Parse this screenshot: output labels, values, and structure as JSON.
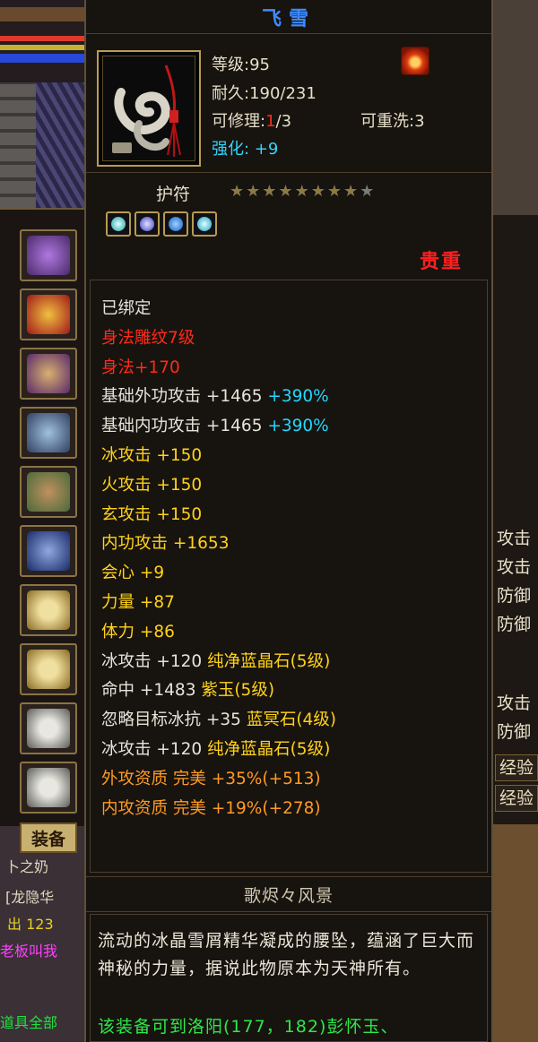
{
  "item": {
    "name": "飞雪",
    "level_label": "等级:95",
    "durability_label": "耐久:190/231",
    "repair_prefix": "可修理:",
    "repair_current": "1",
    "repair_suffix": "/3",
    "rewash_label": "可重洗:3",
    "strength_label": "强化: +9",
    "charm_label": "护符",
    "star_glyph": "★",
    "stars_filled": 8,
    "stars_total": 9,
    "rarity": "贵重",
    "set_name": "歌烬々风景"
  },
  "attributes": [
    {
      "text": "已绑定",
      "color": "white"
    },
    {
      "text": "身法雕纹7级",
      "color": "red"
    },
    {
      "text": "身法+170",
      "color": "red"
    },
    {
      "text": "基础外功攻击 +1465",
      "color": "white",
      "extra": " +390%",
      "extra_color": "cyan"
    },
    {
      "text": "基础内功攻击 +1465",
      "color": "white",
      "extra": " +390%",
      "extra_color": "cyan"
    },
    {
      "text": "冰攻击 +150",
      "color": "yellow"
    },
    {
      "text": "火攻击 +150",
      "color": "yellow"
    },
    {
      "text": "玄攻击 +150",
      "color": "yellow"
    },
    {
      "text": "内功攻击 +1653",
      "color": "yellow"
    },
    {
      "text": "会心 +9",
      "color": "yellow"
    },
    {
      "text": "力量 +87",
      "color": "yellow"
    },
    {
      "text": "体力 +86",
      "color": "yellow"
    },
    {
      "text": "冰攻击 +120 ",
      "color": "white",
      "extra": "纯净蓝晶石(5级)",
      "extra_color": "yellow"
    },
    {
      "text": "命中 +1483 ",
      "color": "white",
      "extra": "紫玉(5级)",
      "extra_color": "yellow"
    },
    {
      "text": "忽略目标冰抗 +35 ",
      "color": "white",
      "extra": "蓝冥石(4级)",
      "extra_color": "yellow"
    },
    {
      "text": "冰攻击 +120 ",
      "color": "white",
      "extra": "纯净蓝晶石(5级)",
      "extra_color": "yellow"
    },
    {
      "text": "外攻资质  完美 +35%(+513)",
      "color": "orange"
    },
    {
      "text": "内攻资质  完美 +19%(+278)",
      "color": "orange"
    }
  ],
  "description": "流动的冰晶雪屑精华凝成的腰坠，蕴涵了巨大而神秘的力量，据说此物原本为天神所有。",
  "location_hint": "该装备可到洛阳(177，182)彭怀玉、",
  "left_panel": {
    "equip_tab": "装备",
    "line1": "卜之奶",
    "line2": "[龙隐华",
    "line3": "出  123",
    "line4": "老板叫我",
    "line5": "道具全部"
  },
  "right_panel": {
    "labels": [
      "攻击",
      "攻击",
      "防御",
      "防御",
      "攻击",
      "防御"
    ],
    "exp1": "经验",
    "exp2": "经验"
  },
  "colors": {
    "title": "#3d8cff",
    "rarity": "#ff2020",
    "strength": "#30d6ff",
    "location": "#2ee84a"
  }
}
